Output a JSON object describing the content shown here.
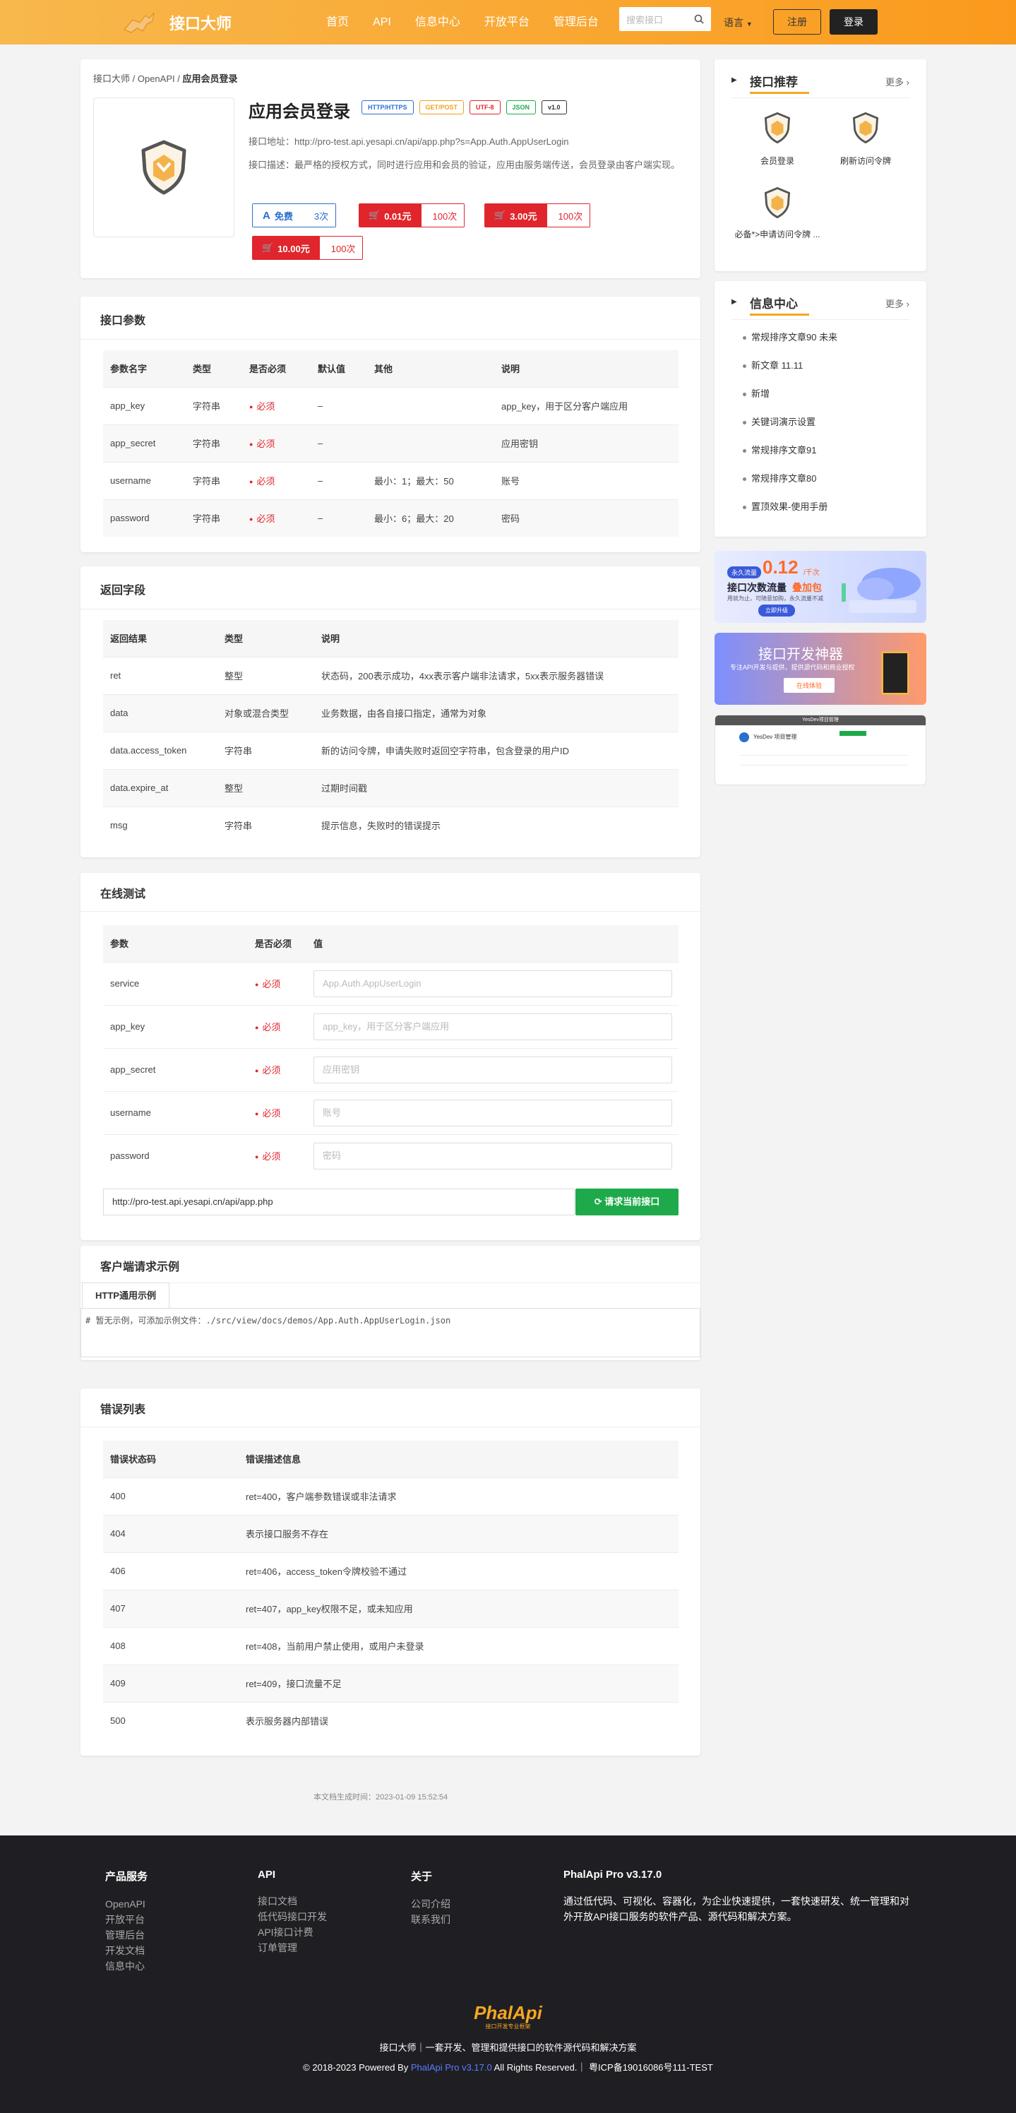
{
  "header": {
    "brand": "接口大师",
    "nav": [
      "首页",
      "API",
      "信息中心",
      "开放平台",
      "管理后台"
    ],
    "search_placeholder": "搜索接口",
    "lang": "语言",
    "register": "注册",
    "login": "登录",
    "colors": {
      "bar_start": "#f8b84c",
      "bar_end": "#fa9a1d"
    }
  },
  "breadcrumb": [
    "接口大师",
    "OpenAPI",
    "应用会员登录"
  ],
  "api": {
    "name": "应用会员登录",
    "tags": [
      {
        "label": "HTTP/HTTPS",
        "color": "#2a6fd0"
      },
      {
        "label": "GET/POST",
        "color": "#f0a020"
      },
      {
        "label": "UTF-8",
        "color": "#e0262c"
      },
      {
        "label": "JSON",
        "color": "#1eaa4a"
      },
      {
        "label": "v1.0",
        "color": "#333333"
      }
    ],
    "address": "接口地址：http://pro-test.api.yesapi.cn/api/app.php?s=App.Auth.AppUserLogin",
    "description": "接口描述：最严格的授权方式，同时进行应用和会员的验证，应用由服务端传送，会员登录由客户端实现。",
    "prices": [
      {
        "label": "免费",
        "count": "3次",
        "free": true
      },
      {
        "label": "0.01元",
        "count": "100次",
        "free": false
      },
      {
        "label": "3.00元",
        "count": "100次",
        "free": false
      },
      {
        "label": "10.00元",
        "count": "100次",
        "free": false
      }
    ]
  },
  "params": {
    "title": "接口参数",
    "headers": [
      "参数名字",
      "类型",
      "是否必须",
      "默认值",
      "其他",
      "说明"
    ],
    "rows": [
      [
        "app_key",
        "字符串",
        "必须",
        "–",
        "",
        "app_key，用于区分客户端应用"
      ],
      [
        "app_secret",
        "字符串",
        "必须",
        "–",
        "",
        "应用密钥"
      ],
      [
        "username",
        "字符串",
        "必须",
        "–",
        "最小：1；最大：50",
        "账号"
      ],
      [
        "password",
        "字符串",
        "必须",
        "–",
        "最小：6；最大：20",
        "密码"
      ]
    ]
  },
  "returns": {
    "title": "返回字段",
    "headers": [
      "返回结果",
      "类型",
      "说明"
    ],
    "rows": [
      [
        "ret",
        "整型",
        "状态码，200表示成功，4xx表示客户端非法请求，5xx表示服务器错误"
      ],
      [
        "data",
        "对象或混合类型",
        "业务数据，由各自接口指定，通常为对象"
      ],
      [
        "data.access_token",
        "字符串",
        "新的访问令牌，申请失败时返回空字符串，包含登录的用户ID"
      ],
      [
        "data.expire_at",
        "整型",
        "过期时间戳"
      ],
      [
        "msg",
        "字符串",
        "提示信息，失败时的错误提示"
      ]
    ]
  },
  "test": {
    "title": "在线测试",
    "headers": [
      "参数",
      "是否必须",
      "值"
    ],
    "rows": [
      {
        "name": "service",
        "req": "必须",
        "placeholder": "App.Auth.AppUserLogin"
      },
      {
        "name": "app_key",
        "req": "必须",
        "placeholder": "app_key，用于区分客户端应用"
      },
      {
        "name": "app_secret",
        "req": "必须",
        "placeholder": "应用密钥"
      },
      {
        "name": "username",
        "req": "必须",
        "placeholder": "账号"
      },
      {
        "name": "password",
        "req": "必须",
        "placeholder": "密码"
      }
    ],
    "url": "http://pro-test.api.yesapi.cn/api/app.php",
    "submit": "请求当前接口"
  },
  "client": {
    "title": "客户端请求示例",
    "tab": "HTTP通用示例",
    "code": "# 暂无示例，可添加示例文件：./src/view/docs/demos/App.Auth.AppUserLogin.json"
  },
  "errors": {
    "title": "错误列表",
    "headers": [
      "错误状态码",
      "错误描述信息"
    ],
    "rows": [
      [
        "400",
        "ret=400，客户端参数错误或非法请求"
      ],
      [
        "404",
        "表示接口服务不存在"
      ],
      [
        "406",
        "ret=406，access_token令牌校验不通过"
      ],
      [
        "407",
        "ret=407，app_key权限不足，或未知应用"
      ],
      [
        "408",
        "ret=408，当前用户禁止使用，或用户未登录"
      ],
      [
        "409",
        "ret=409，接口流量不足"
      ],
      [
        "500",
        "表示服务器内部错误"
      ]
    ]
  },
  "generated": "本文档生成时间：2023-01-09 15:52:54",
  "sidebar": {
    "recommend": {
      "title": "接口推荐",
      "more": "更多",
      "items": [
        "会员登录",
        "刷新访问令牌",
        "必备*>申请访问令牌 ..."
      ]
    },
    "info": {
      "title": "信息中心",
      "more": "更多",
      "items": [
        "常规排序文章90 未来",
        "新文章 11.11",
        "新增",
        "关键词演示设置",
        "常规排序文章91",
        "常规排序文章80",
        "置顶效果-使用手册"
      ]
    },
    "banner1": {
      "badge": "永久流量",
      "price": "0.12",
      "unit": "/千次",
      "line": "接口次数流量",
      "highlight": "叠加包",
      "sub": "用就为止，可随意加购，永久流量不减",
      "btn": "立即升级"
    },
    "banner2": {
      "title": "接口开发神器",
      "sub": "专注API开发与提供，提供源代码和商业授权",
      "btn": "在线体验"
    },
    "banner3": {
      "title": "YesDev项目管理",
      "app": "YesDev 项目管理"
    }
  },
  "footer": {
    "cols": [
      {
        "title": "产品服务",
        "items": [
          "OpenAPI",
          "开放平台",
          "管理后台",
          "开发文档",
          "信息中心"
        ]
      },
      {
        "title": "API",
        "items": [
          "接口文档",
          "低代码接口开发",
          "API接口计费",
          "订单管理"
        ]
      },
      {
        "title": "关于",
        "items": [
          "公司介绍",
          "联系我们"
        ]
      }
    ],
    "about_title": "PhalApi Pro v3.17.0",
    "about_text": "通过低代码、可视化、容器化，为企业快速提供，一套快速研发、统一管理和对外开放API接口服务的软件产品、源代码和解决方案。",
    "logo": "PhalApi",
    "logo_sub": "接口开发专业框架",
    "slogan": "接口大师｜一套开发、管理和提供接口的软件源代码和解决方案",
    "copyright_pre": "© 2018-2023 Powered By",
    "copyright_link": "PhalApi Pro v3.17.0",
    "copyright_post": "All Rights Reserved.｜ 粤ICP备19016086号111-TEST"
  }
}
